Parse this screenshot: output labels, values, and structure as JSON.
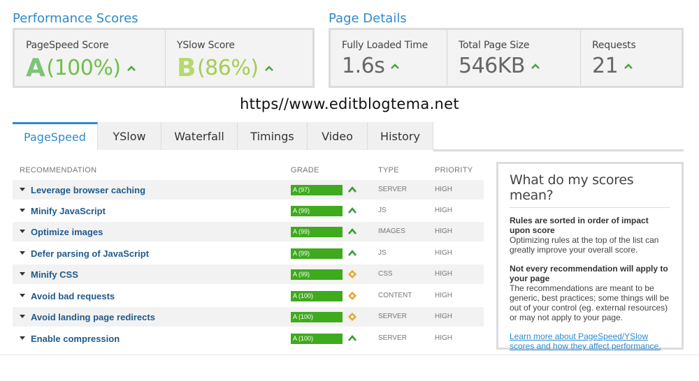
{
  "performance": {
    "title": "Performance Scores",
    "pagespeed": {
      "label": "PageSpeed Score",
      "grade": "A",
      "value": "(100%)"
    },
    "yslow": {
      "label": "YSlow Score",
      "grade": "B",
      "value": "(86%)"
    }
  },
  "details": {
    "title": "Page Details",
    "load_time": {
      "label": "Fully Loaded Time",
      "value": "1.6s"
    },
    "page_size": {
      "label": "Total Page Size",
      "value": "546KB"
    },
    "requests": {
      "label": "Requests",
      "value": "21"
    }
  },
  "watermark": "https//www.editblogtema.net",
  "tabs": [
    "PageSpeed",
    "YSlow",
    "Waterfall",
    "Timings",
    "Video",
    "History"
  ],
  "table": {
    "headers": {
      "recommendation": "RECOMMENDATION",
      "grade": "GRADE",
      "type": "TYPE",
      "priority": "PRIORITY"
    },
    "rows": [
      {
        "name": "Leverage browser caching",
        "grade": "A (97)",
        "trend": "up",
        "type": "SERVER",
        "priority": "HIGH"
      },
      {
        "name": "Minify JavaScript",
        "grade": "A (99)",
        "trend": "up",
        "type": "JS",
        "priority": "HIGH"
      },
      {
        "name": "Optimize images",
        "grade": "A (99)",
        "trend": "up",
        "type": "IMAGES",
        "priority": "HIGH"
      },
      {
        "name": "Defer parsing of JavaScript",
        "grade": "A (99)",
        "trend": "up",
        "type": "JS",
        "priority": "HIGH"
      },
      {
        "name": "Minify CSS",
        "grade": "A (99)",
        "trend": "neutral",
        "type": "CSS",
        "priority": "HIGH"
      },
      {
        "name": "Avoid bad requests",
        "grade": "A (100)",
        "trend": "neutral",
        "type": "CONTENT",
        "priority": "HIGH"
      },
      {
        "name": "Avoid landing page redirects",
        "grade": "A (100)",
        "trend": "neutral",
        "type": "SERVER",
        "priority": "HIGH"
      },
      {
        "name": "Enable compression",
        "grade": "A (100)",
        "trend": "up",
        "type": "SERVER",
        "priority": "HIGH"
      }
    ]
  },
  "info": {
    "title": "What do my scores mean?",
    "p1_bold": "Rules are sorted in order of impact upon score",
    "p1_text": "Optimizing rules at the top of the list can greatly improve your overall score.",
    "p2_bold": "Not every recommendation will apply to your page",
    "p2_text": "The recommendations are meant to be generic, best practices; some things will be out of your control (eg. external resources) or may not apply to your page.",
    "link": "Learn more about PageSpeed/YSlow scores and how they affect performance."
  },
  "colors": {
    "accent": "#2f8ac9",
    "grade_bar": "#3faa1e",
    "trend_up": "#3a9a3a",
    "trend_neutral": "#e8a42a"
  }
}
